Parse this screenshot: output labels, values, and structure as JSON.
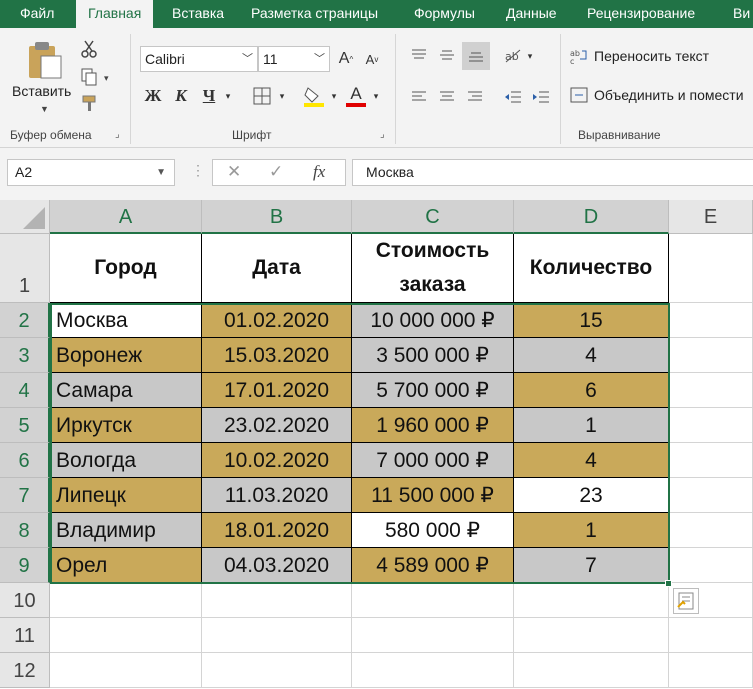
{
  "tabs": [
    "Файл",
    "Главная",
    "Вставка",
    "Разметка страницы",
    "Формулы",
    "Данные",
    "Рецензирование",
    "Ви"
  ],
  "ribbon": {
    "clipboard": {
      "paste_label": "Вставить",
      "group_label": "Буфер обмена"
    },
    "font": {
      "font_name": "Calibri",
      "font_size": "11",
      "bold": "Ж",
      "italic": "К",
      "underline": "Ч",
      "grow": "A",
      "shrink": "A",
      "font_color_letter": "A",
      "group_label": "Шрифт",
      "highlight_color": "#ffe600",
      "font_color": "#e00000"
    },
    "alignment": {
      "wrap_text": "Переносить текст",
      "merge_center": "Объединить и помести",
      "group_label": "Выравнивание"
    }
  },
  "formula_bar": {
    "name_box": "A2",
    "fx": "fx",
    "value": "Москва"
  },
  "columns": [
    "A",
    "B",
    "C",
    "D",
    "E"
  ],
  "rows": [
    "1",
    "2",
    "3",
    "4",
    "5",
    "6",
    "7",
    "8",
    "9",
    "10",
    "11",
    "12"
  ],
  "table": {
    "headers": [
      "Город",
      "Дата",
      "Стоимость заказа",
      "Количество"
    ],
    "header_c_lines": [
      "Стоимость",
      "заказа"
    ],
    "data": [
      [
        "Москва",
        "01.02.2020",
        "10 000 000 ₽",
        "15"
      ],
      [
        "Воронеж",
        "15.03.2020",
        "3 500 000 ₽",
        "4"
      ],
      [
        "Самара",
        "17.01.2020",
        "5 700 000 ₽",
        "6"
      ],
      [
        "Иркутск",
        "23.02.2020",
        "1 960 000 ₽",
        "1"
      ],
      [
        "Вологда",
        "10.02.2020",
        "7 000 000 ₽",
        "4"
      ],
      [
        "Липецк",
        "11.03.2020",
        "11 500 000 ₽",
        "23"
      ],
      [
        "Владимир",
        "18.01.2020",
        "580 000 ₽",
        "1"
      ],
      [
        "Орел",
        "04.03.2020",
        "4 589 000 ₽",
        "7"
      ]
    ]
  },
  "colors": {
    "accent": "#217346",
    "gold": "#c9a95a",
    "gray": "#c8c8c8"
  }
}
